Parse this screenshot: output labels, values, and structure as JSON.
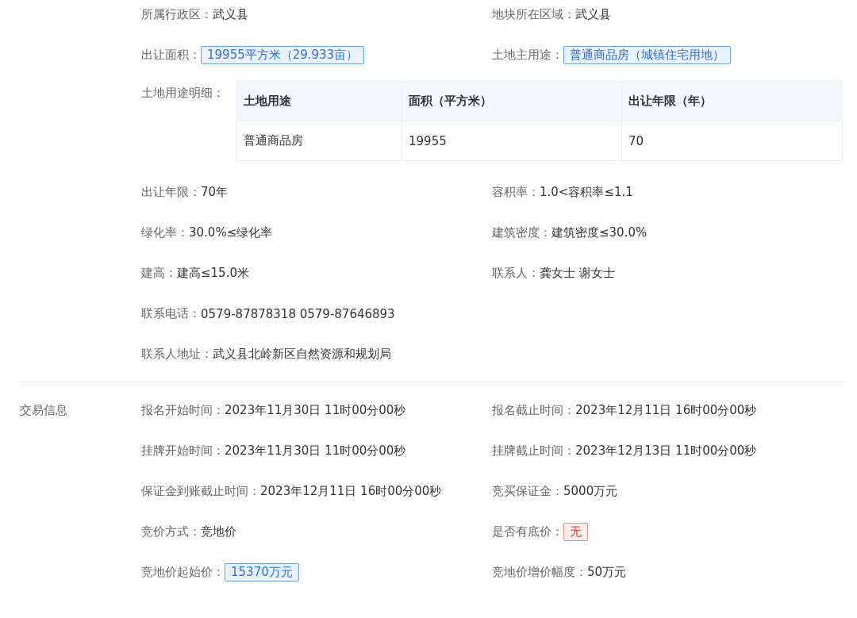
{
  "sections": [
    {
      "rows": [
        {
          "kind": "fields",
          "fields": [
            {
              "label": "所属行政区：",
              "value": "武义县",
              "kind": "plain"
            },
            {
              "label": "地块所在区域：",
              "value": "武义县",
              "kind": "plain"
            }
          ]
        },
        {
          "kind": "fields",
          "fields": [
            {
              "label": "出让面积：",
              "value": "19955平方米（29.933亩）",
              "kind": "blue_tag"
            },
            {
              "label": "土地主用途：",
              "value": "普通商品房（城镇住宅用地）",
              "kind": "blue_tag"
            }
          ]
        },
        {
          "kind": "table",
          "label": "土地用途明细：",
          "columns": [
            "土地用途",
            "面积（平方米）",
            "出让年限（年）"
          ],
          "rows": [
            [
              "普通商品房",
              "19955",
              "70"
            ]
          ]
        },
        {
          "kind": "fields",
          "fields": [
            {
              "label": "出让年限：",
              "value": "70年",
              "kind": "plain"
            },
            {
              "label": "容积率：",
              "value": "1.0<容积率≤1.1",
              "kind": "plain"
            }
          ]
        },
        {
          "kind": "fields",
          "fields": [
            {
              "label": "绿化率：",
              "value": "30.0%≤绿化率",
              "kind": "plain"
            },
            {
              "label": "建筑密度：",
              "value": "建筑密度≤30.0%",
              "kind": "plain"
            }
          ]
        },
        {
          "kind": "fields",
          "fields": [
            {
              "label": "建高：",
              "value": "建高≤15.0米",
              "kind": "plain"
            },
            {
              "label": "联系人：",
              "value": "龚女士 谢女士",
              "kind": "plain"
            }
          ]
        },
        {
          "kind": "fields",
          "fields": [
            {
              "label": "联系电话：",
              "value": "0579-87878318 0579-87646893",
              "kind": "plain"
            }
          ]
        },
        {
          "kind": "fields",
          "fields": [
            {
              "label": "联系人地址：",
              "value": "武义县北岭新区自然资源和规划局",
              "kind": "plain"
            }
          ]
        }
      ]
    },
    {
      "label": "交易信息",
      "rows": [
        {
          "kind": "fields",
          "fields": [
            {
              "label": "报名开始时间：",
              "value": "2023年11月30日 11时00分00秒",
              "kind": "plain"
            },
            {
              "label": "报名截止时间：",
              "value": "2023年12月11日 16时00分00秒",
              "kind": "plain"
            }
          ]
        },
        {
          "kind": "fields",
          "fields": [
            {
              "label": "挂牌开始时间：",
              "value": "2023年11月30日 11时00分00秒",
              "kind": "plain"
            },
            {
              "label": "挂牌截止时间：",
              "value": "2023年12月13日 11时00分00秒",
              "kind": "plain"
            }
          ]
        },
        {
          "kind": "fields",
          "fields": [
            {
              "label": "保证金到账截止时间：",
              "value": "2023年12月11日 16时00分00秒",
              "kind": "plain"
            },
            {
              "label": "竞买保证金：",
              "value": "5000万元",
              "kind": "plain"
            }
          ]
        },
        {
          "kind": "fields",
          "fields": [
            {
              "label": "竞价方式：",
              "value": "竞地价",
              "kind": "plain"
            },
            {
              "label": "是否有底价：",
              "value": "无",
              "kind": "red_tag"
            }
          ]
        },
        {
          "kind": "fields",
          "fields": [
            {
              "label": "竞地价起始价：",
              "value": "15370万元",
              "kind": "blue_tag"
            },
            {
              "label": "竞地价增价幅度：",
              "value": "50万元",
              "kind": "plain"
            }
          ]
        }
      ]
    }
  ]
}
